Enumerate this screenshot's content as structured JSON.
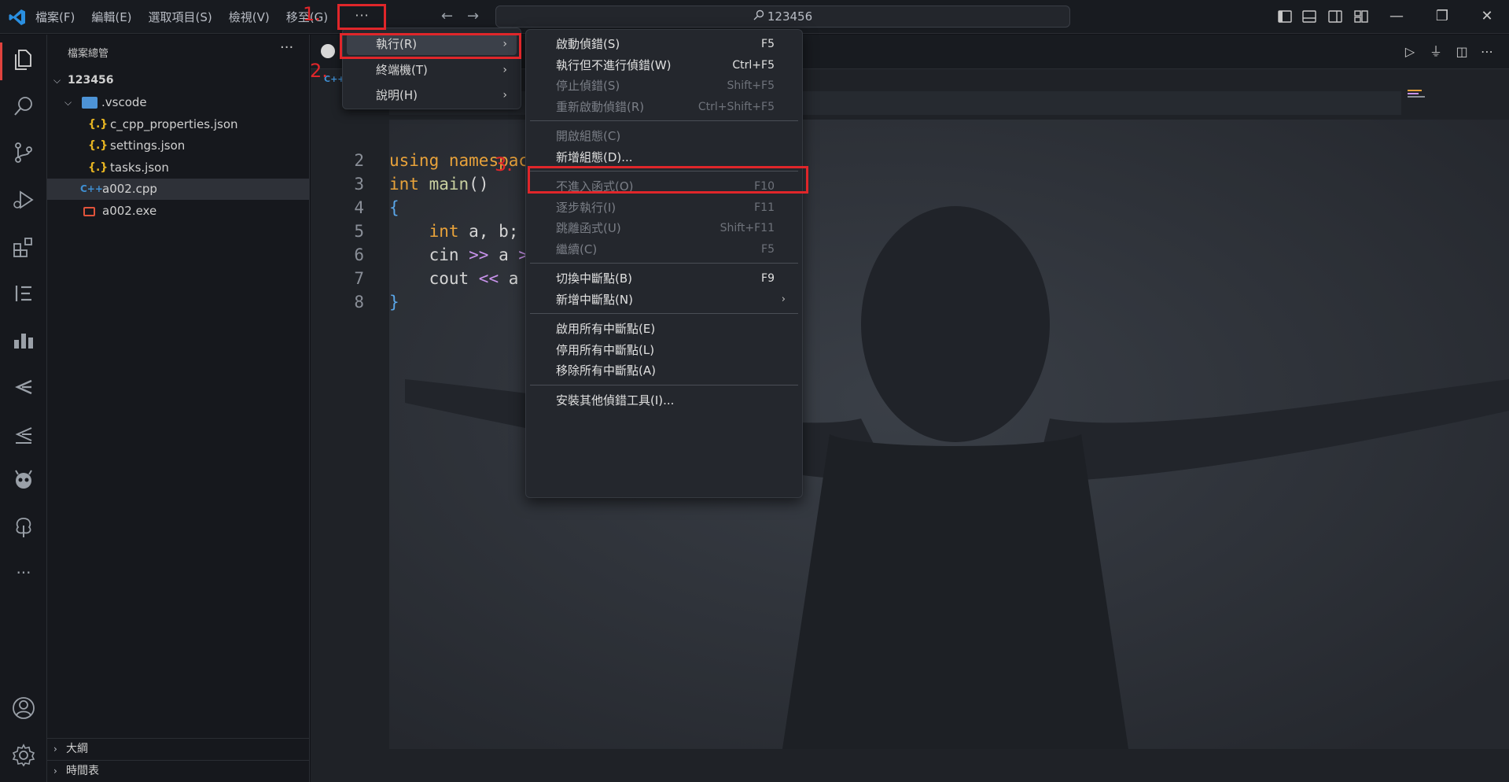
{
  "titlebar": {
    "menu": [
      "檔案(F)",
      "編輯(E)",
      "選取項目(S)",
      "檢視(V)",
      "移至(G)"
    ],
    "more_label": "···",
    "search_text": "123456",
    "window_controls": [
      "minimize-icon",
      "restore-icon",
      "close-icon"
    ]
  },
  "activity_bar": {
    "icons": [
      "explorer-icon",
      "search-icon",
      "source-control-icon",
      "run-debug-icon",
      "extensions-icon",
      "timeline-icon",
      "chart-icon",
      "gitlens-icon",
      "gitlens-inspect-icon",
      "platformio-icon",
      "tree-icon",
      "more-icon",
      "account-icon",
      "settings-icon"
    ],
    "more_label": "···"
  },
  "sidebar": {
    "title": "檔案總管",
    "more_label": "···",
    "root": "123456",
    "tree": [
      {
        "label": ".vscode",
        "type": "folder"
      },
      {
        "label": "c_cpp_properties.json",
        "type": "json"
      },
      {
        "label": "settings.json",
        "type": "json"
      },
      {
        "label": "tasks.json",
        "type": "json"
      },
      {
        "label": "a002.cpp",
        "type": "cpp"
      },
      {
        "label": "a002.exe",
        "type": "exe"
      }
    ],
    "sections": [
      "大綱",
      "時間表"
    ],
    "json_glyph": "{.}",
    "cpp_glyph": "C++"
  },
  "editor": {
    "breadcrumb_glyph": "C++",
    "lines": [
      {
        "n": "2",
        "parts": [
          [
            "kw",
            "using"
          ],
          [
            "plain",
            " "
          ],
          [
            "kw",
            "namespac"
          ]
        ]
      },
      {
        "n": "3",
        "parts": [
          [
            "kw",
            "int"
          ],
          [
            "plain",
            " "
          ],
          [
            "fn",
            "main"
          ],
          [
            "plain",
            "()"
          ]
        ]
      },
      {
        "n": "4",
        "parts": [
          [
            "brace",
            "{"
          ]
        ]
      },
      {
        "n": "5",
        "parts": [
          [
            "plain",
            "    "
          ],
          [
            "kw",
            "int"
          ],
          [
            "plain",
            " a, b;"
          ]
        ]
      },
      {
        "n": "6",
        "parts": [
          [
            "plain",
            "    cin "
          ],
          [
            "op",
            ">>"
          ],
          [
            "plain",
            " a "
          ],
          [
            "op",
            ">"
          ]
        ]
      },
      {
        "n": "7",
        "parts": [
          [
            "plain",
            "    cout "
          ],
          [
            "op",
            "<<"
          ],
          [
            "plain",
            " a"
          ]
        ]
      },
      {
        "n": "8",
        "parts": [
          [
            "brace",
            "}"
          ]
        ]
      }
    ]
  },
  "menu_more": {
    "items": [
      {
        "label": "執行(R)"
      },
      {
        "label": "終端機(T)"
      },
      {
        "label": "說明(H)"
      }
    ],
    "arrow": "›"
  },
  "menu_run": {
    "groups": [
      [
        {
          "label": "啟動偵錯(S)",
          "key": "F5",
          "disabled": false
        },
        {
          "label": "執行但不進行偵錯(W)",
          "key": "Ctrl+F5",
          "disabled": false
        },
        {
          "label": "停止偵錯(S)",
          "key": "Shift+F5",
          "disabled": true
        },
        {
          "label": "重新啟動偵錯(R)",
          "key": "Ctrl+Shift+F5",
          "disabled": true
        }
      ],
      [
        {
          "label": "開啟組態(C)",
          "key": "",
          "disabled": true
        },
        {
          "label": "新增組態(D)...",
          "key": "",
          "disabled": false
        }
      ],
      [
        {
          "label": "不進入函式(O)",
          "key": "F10",
          "disabled": true
        },
        {
          "label": "逐步執行(I)",
          "key": "F11",
          "disabled": true
        },
        {
          "label": "跳離函式(U)",
          "key": "Shift+F11",
          "disabled": true
        },
        {
          "label": "繼續(C)",
          "key": "F5",
          "disabled": true
        }
      ],
      [
        {
          "label": "切換中斷點(B)",
          "key": "F9",
          "disabled": false
        },
        {
          "label": "新增中斷點(N)",
          "key": "",
          "disabled": false,
          "submenu": true
        }
      ],
      [
        {
          "label": "啟用所有中斷點(E)",
          "key": "",
          "disabled": false
        },
        {
          "label": "停用所有中斷點(L)",
          "key": "",
          "disabled": false
        },
        {
          "label": "移除所有中斷點(A)",
          "key": "",
          "disabled": false
        }
      ],
      [
        {
          "label": "安裝其他偵錯工具(I)...",
          "key": "",
          "disabled": false
        }
      ]
    ],
    "arrow": "›"
  },
  "annotations": {
    "step1": "1.",
    "step2": "2.",
    "step3": "3.",
    "color": "#e0262a"
  },
  "colors": {
    "accent_red": "#e0262a",
    "keyword": "#e8a23a",
    "operator": "#c792ea",
    "brace": "#5aa6e8",
    "json_icon": "#e6b422",
    "cpp_icon": "#3f8fd2"
  }
}
